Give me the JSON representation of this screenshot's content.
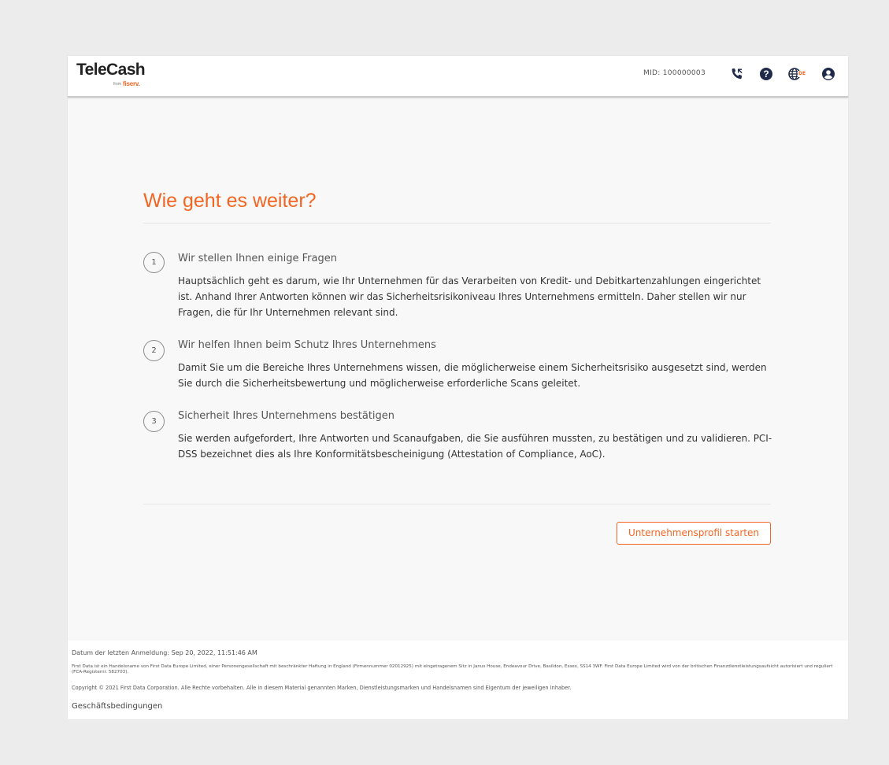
{
  "header": {
    "logo": {
      "brand": "TeleCash",
      "from": "from",
      "fiserv": "fiserv."
    },
    "mid_label": "MID: 100000003",
    "icons": [
      "phone-icon",
      "help-icon",
      "language-globe-icon",
      "user-account-icon"
    ],
    "language_code": "DE"
  },
  "main": {
    "title": "Wie geht es weiter?",
    "steps": [
      {
        "number": "1",
        "title": "Wir stellen Ihnen einige Fragen",
        "body": "Hauptsächlich geht es darum, wie Ihr Unternehmen für das Verarbeiten von Kredit- und Debitkartenzahlungen eingerichtet ist. Anhand Ihrer Antworten können wir das Sicherheitsrisikoniveau Ihres Unternehmens ermitteln. Daher stellen wir nur Fragen, die für Ihr Unternehmen relevant sind."
      },
      {
        "number": "2",
        "title": "Wir helfen Ihnen beim Schutz Ihres Unternehmens",
        "body": "Damit Sie um die Bereiche Ihres Unternehmens wissen, die möglicherweise einem Sicherheitsrisiko ausgesetzt sind, werden Sie durch die Sicherheitsbewertung und möglicherweise erforderliche Scans geleitet."
      },
      {
        "number": "3",
        "title": "Sicherheit Ihres Unternehmens bestätigen",
        "body": "Sie werden aufgefordert, Ihre Antworten und Scanaufgaben, die Sie ausführen mussten, zu bestätigen und zu validieren. PCI-DSS bezeichnet dies als Ihre Konformitätsbescheinigung (Attestation of Compliance, AoC)."
      }
    ],
    "cta_label": "Unternehmensprofil starten"
  },
  "footer": {
    "last_login": "Datum der letzten Anmeldung: Sep 20, 2022, 11:51:46 AM",
    "legal": "First Data ist ein Handelsname von First Data Europe Limited, einer Personengesellschaft mit beschränkter Haftung in England (Firmennummer 02012925) mit eingetragenem Sitz in Janus House, Endeavour Drive, Basildon, Essex, SS14 3WF. First Data Europe Limited wird von der britischen Finanzdienstleistungsaufsicht autorisiert und reguliert (FCA-Registernr. 582703).",
    "copyright": "Copyright © 2021 First Data Corporation. Alle Rechte vorbehalten. Alle in diesem Material genannten Marken, Dienstleistungsmarken und Handelsnamen sind Eigentum der jeweiligen Inhaber.",
    "terms_link": "Geschäftsbedingungen"
  },
  "colors": {
    "accent": "#f26522",
    "icon_navy": "#1f2a4a",
    "page_bg": "#ececec",
    "content_bg": "#f8f8f8"
  }
}
